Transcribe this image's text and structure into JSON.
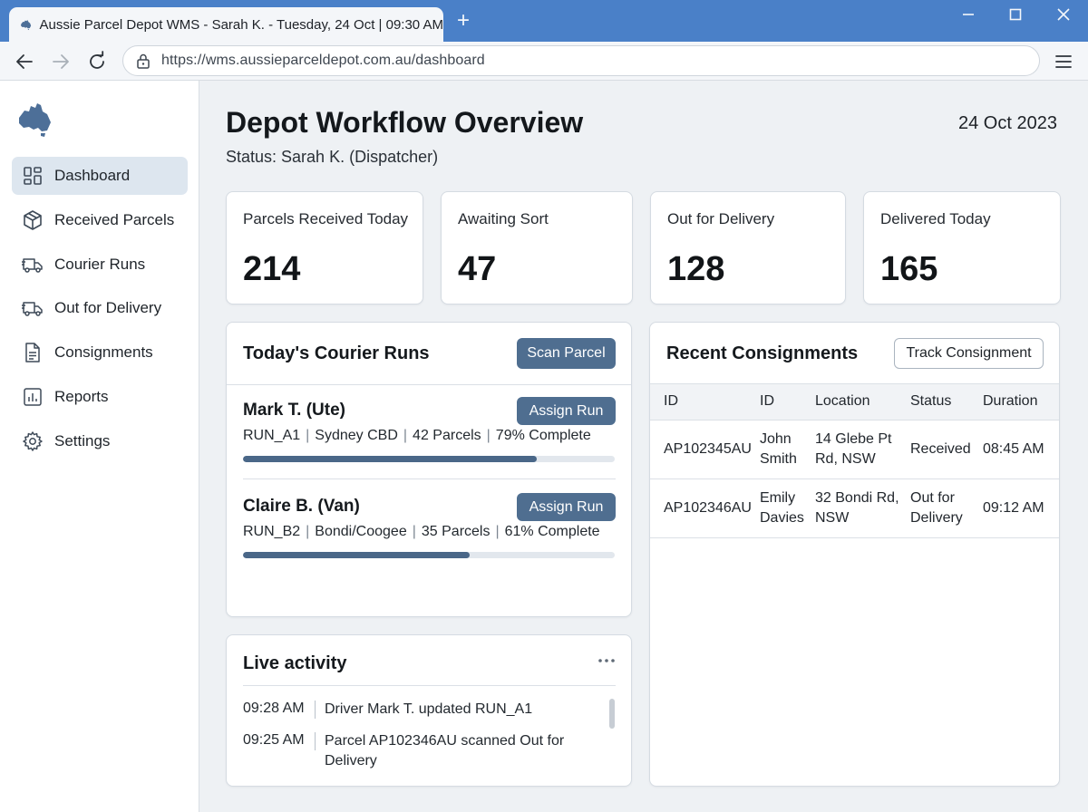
{
  "window": {
    "tab_title": "Aussie Parcel Depot WMS - Sarah K. - Tuesday, 24 Oct | 09:30 AM",
    "url": "https://wms.aussieparceldepot.com.au/dashboard"
  },
  "sidebar": {
    "items": [
      {
        "label": "Dashboard",
        "icon": "grid-icon",
        "active": true
      },
      {
        "label": "Received Parcels",
        "icon": "box-icon"
      },
      {
        "label": "Courier Runs",
        "icon": "truck-icon"
      },
      {
        "label": "Out for Delivery",
        "icon": "truck-icon"
      },
      {
        "label": "Consignments",
        "icon": "document-icon"
      },
      {
        "label": "Reports",
        "icon": "chart-icon"
      },
      {
        "label": "Settings",
        "icon": "gear-icon"
      }
    ]
  },
  "header": {
    "title": "Depot Workflow Overview",
    "status": "Status: Sarah K. (Dispatcher)",
    "date": "24 Oct 2023"
  },
  "stats": [
    {
      "label": "Parcels Received Today",
      "value": "214"
    },
    {
      "label": "Awaiting Sort",
      "value": "47"
    },
    {
      "label": "Out for Delivery",
      "value": "128"
    },
    {
      "label": "Delivered Today",
      "value": "165"
    }
  ],
  "courier_runs": {
    "title": "Today's Courier Runs",
    "scan_button": "Scan Parcel",
    "runs": [
      {
        "name": "Mark T. (Ute)",
        "button": "Assign Run",
        "run_id": "RUN_A1",
        "area": "Sydney CBD",
        "parcels": "42 Parcels",
        "complete": "79% Complete",
        "progress": 0.79
      },
      {
        "name": "Claire B. (Van)",
        "button": "Assign Run",
        "run_id": "RUN_B2",
        "area": "Bondi/Coogee",
        "parcels": "35 Parcels",
        "complete": "61% Complete",
        "progress": 0.61
      }
    ]
  },
  "consignments": {
    "title": "Recent Consignments",
    "track_button": "Track Consignment",
    "columns": [
      "ID",
      "ID",
      "Location",
      "Status",
      "Duration"
    ],
    "rows": [
      {
        "id": "AP102345AU",
        "name": "John Smith",
        "location": "14 Glebe Pt Rd, NSW",
        "status": "Received",
        "duration": "08:45 AM"
      },
      {
        "id": "AP102346AU",
        "name": "Emily Davies",
        "location": "32 Bondi Rd, NSW",
        "status": "Out for Delivery",
        "duration": "09:12 AM"
      }
    ]
  },
  "activity": {
    "title": "Live activity",
    "items": [
      {
        "time": "09:28 AM",
        "text": "Driver Mark T. updated RUN_A1"
      },
      {
        "time": "09:25 AM",
        "text": "Parcel AP102346AU scanned Out for Delivery"
      }
    ]
  },
  "colors": {
    "titlebar": "#4a80c8",
    "accent_button": "#4f6e90",
    "progress_fill": "#4a6788",
    "active_nav": "#dde6ef",
    "logo": "#4d6f98"
  }
}
